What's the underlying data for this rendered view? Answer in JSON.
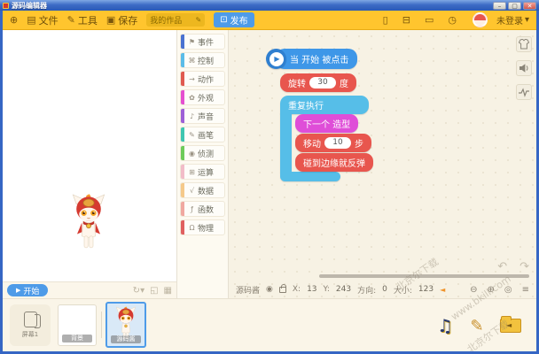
{
  "window": {
    "title": "源码编辑器",
    "controls": {
      "minimize": "–",
      "maximize": "▢",
      "close": "✕"
    }
  },
  "icons": {
    "globe": "⊕",
    "file": "▤",
    "tools": "✎",
    "save": "▣",
    "edit_pencil": "✎",
    "publish": "⊡",
    "phone": "▯",
    "box": "⊟",
    "folder": "▭",
    "clock": "◷",
    "caret_down": "▾",
    "play": "▶",
    "start_play": "▶",
    "rotate_device": "↻",
    "fullscreen": "◱",
    "grid": "▦",
    "eye": "◉",
    "zoom_out": "⊖",
    "zoom_in": "⊕",
    "target": "◎",
    "menu": "≡",
    "undo": "↶",
    "redo": "↷",
    "music": "♫",
    "paint": "✎"
  },
  "menu_bar": {
    "file": "文件",
    "tools": "工具",
    "save": "保存",
    "project_name": "我的作品",
    "publish": "发布",
    "login": "未登录"
  },
  "palette": {
    "categories": [
      {
        "name": "events",
        "label": "事件",
        "color": "#4A72D1",
        "glyph": "⚑"
      },
      {
        "name": "control",
        "label": "控制",
        "color": "#5BBCE8",
        "glyph": "⌘"
      },
      {
        "name": "motion",
        "label": "动作",
        "color": "#E05A50",
        "glyph": "→"
      },
      {
        "name": "looks",
        "label": "外观",
        "color": "#E54FD0",
        "glyph": "✿"
      },
      {
        "name": "sound",
        "label": "声音",
        "color": "#9D5FD6",
        "glyph": "♪"
      },
      {
        "name": "pen",
        "label": "画笔",
        "color": "#3FC6B0",
        "glyph": "✎"
      },
      {
        "name": "sensing",
        "label": "侦测",
        "color": "#6DCB5A",
        "glyph": "◉"
      },
      {
        "name": "operators",
        "label": "运算",
        "color": "#F2BCC8",
        "glyph": "⊞"
      },
      {
        "name": "data",
        "label": "数据",
        "color": "#F5C98A",
        "glyph": "√"
      },
      {
        "name": "functions",
        "label": "函数",
        "color": "#F0A8A0",
        "glyph": "ƒ"
      },
      {
        "name": "physics",
        "label": "物理",
        "color": "#E06060",
        "glyph": "Ω"
      }
    ]
  },
  "workspace": {
    "blocks": {
      "hat": {
        "text": "当 开始 被点击"
      },
      "rotate": {
        "prefix": "旋转",
        "value": "30",
        "suffix": "度"
      },
      "repeat": {
        "text": "重复执行"
      },
      "next_costume": {
        "text": "下一个 造型"
      },
      "move": {
        "prefix": "移动",
        "value": "10",
        "suffix": "步"
      },
      "bounce": {
        "text": "碰到边缘就反弹"
      }
    }
  },
  "stage": {
    "start": "开始"
  },
  "status_bar": {
    "sprite_name": "源码酱",
    "x_label": "X:",
    "x": "13",
    "y_label": "Y:",
    "y": "243",
    "dir_label": "方向:",
    "dir": "0",
    "size_label": "大小:",
    "size": "123"
  },
  "bottom_panel": {
    "screen": "屏幕1",
    "background": "背景",
    "sprite": "源码酱"
  },
  "watermark": {
    "line1": "北京尔下载",
    "line2": "www.bkill.com"
  }
}
